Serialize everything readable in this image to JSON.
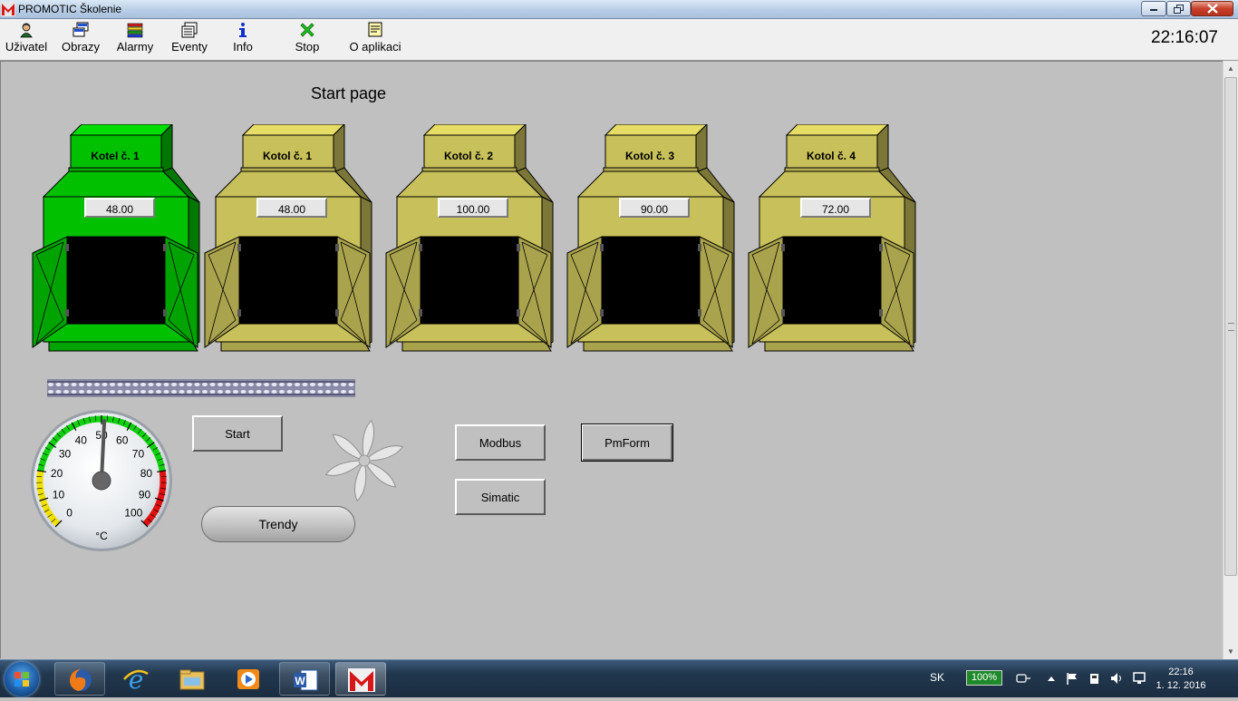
{
  "window": {
    "title": "PROMOTIC Školenie"
  },
  "toolbar": {
    "items": [
      {
        "label": "Uživatel",
        "icon": "user-icon"
      },
      {
        "label": "Obrazy",
        "icon": "screens-icon"
      },
      {
        "label": "Alarmy",
        "icon": "alarms-icon"
      },
      {
        "label": "Eventy",
        "icon": "events-icon"
      },
      {
        "label": "Info",
        "icon": "info-icon"
      },
      {
        "label": "Stop",
        "icon": "stop-icon"
      },
      {
        "label": "O aplikaci",
        "icon": "about-icon"
      }
    ],
    "clock": "22:16:07"
  },
  "page": {
    "title": "Start page",
    "boilers": [
      {
        "name": "Kotel č. 1",
        "value": "48.00",
        "color": "#00c000"
      },
      {
        "name": "Kotol č. 1",
        "value": "48.00",
        "color": "#c8c05a"
      },
      {
        "name": "Kotol č. 2",
        "value": "100.00",
        "color": "#c8c05a"
      },
      {
        "name": "Kotol č. 3",
        "value": "90.00",
        "color": "#c8c05a"
      },
      {
        "name": "Kotol č. 4",
        "value": "72.00",
        "color": "#c8c05a"
      }
    ],
    "gauge": {
      "unit": "°C",
      "ticks": [
        "0",
        "10",
        "20",
        "30",
        "40",
        "50",
        "60",
        "70",
        "80",
        "90",
        "100"
      ],
      "value": 51
    },
    "buttons": {
      "start": "Start",
      "trendy": "Trendy",
      "modbus": "Modbus",
      "simatic": "Simatic",
      "pmform": "PmForm"
    }
  },
  "taskbar": {
    "language": "SK",
    "battery": "100%",
    "time": "22:16",
    "date": "1. 12. 2016"
  },
  "colors": {
    "green_boiler": "#00c000",
    "olive_boiler": "#c8c05a",
    "background": "#c0c0c0"
  }
}
